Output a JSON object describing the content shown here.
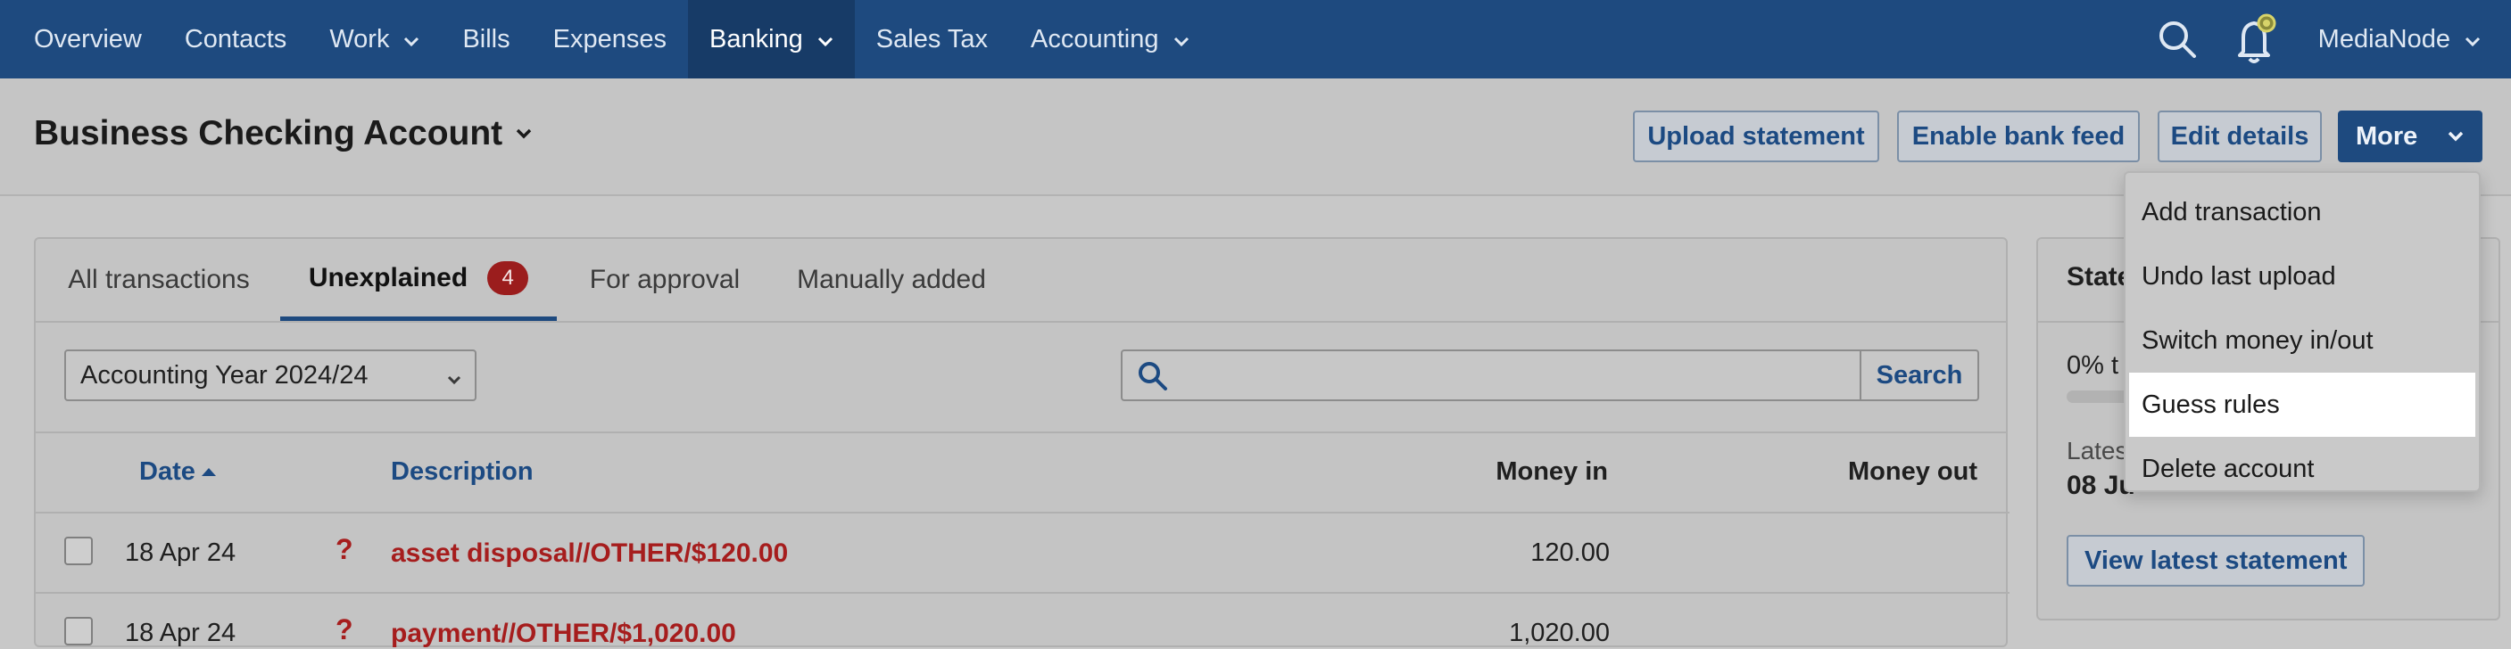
{
  "nav": {
    "items": [
      {
        "label": "Overview"
      },
      {
        "label": "Contacts"
      },
      {
        "label": "Work"
      },
      {
        "label": "Bills"
      },
      {
        "label": "Expenses"
      },
      {
        "label": "Banking"
      },
      {
        "label": "Sales Tax"
      },
      {
        "label": "Accounting"
      }
    ],
    "user": "MediaNode"
  },
  "header": {
    "title": "Business Checking Account",
    "buttons": {
      "upload": "Upload statement",
      "feed": "Enable bank feed",
      "edit": "Edit details",
      "more": "More"
    }
  },
  "tabs": {
    "all": "All transactions",
    "unexplained": "Unexplained",
    "unexplained_count": "4",
    "approval": "For approval",
    "manual": "Manually added"
  },
  "filters": {
    "year_selected": "Accounting Year 2024/24",
    "search_placeholder": "",
    "search_button": "Search"
  },
  "table": {
    "columns": {
      "date": "Date",
      "description": "Description",
      "money_in": "Money in",
      "money_out": "Money out"
    },
    "rows": [
      {
        "date": "18 Apr 24",
        "flag": "?",
        "description": "asset disposal//OTHER/$120.00",
        "money_in": "120.00",
        "money_out": ""
      },
      {
        "date": "18 Apr 24",
        "flag": "?",
        "description": "payment//OTHER/$1,020.00",
        "money_in": "1,020.00",
        "money_out": ""
      }
    ]
  },
  "side": {
    "title": "State",
    "progress_text": "0% t",
    "progress_fraction": 0,
    "latest_label": "Lates",
    "latest_date": "08 Ju",
    "view_button": "View latest statement"
  },
  "menu": {
    "items": [
      {
        "label": "Add transaction"
      },
      {
        "label": "Undo last upload"
      },
      {
        "label": "Switch money in/out"
      },
      {
        "label": "Guess rules"
      },
      {
        "label": "Delete account"
      }
    ]
  },
  "colors": {
    "nav_bg": "#1e4a7f",
    "accent": "#1c4a82",
    "alert": "#a61d1d"
  },
  "icons": [
    "search-icon",
    "bell-icon",
    "chevron-down-icon",
    "sort-up-icon"
  ]
}
